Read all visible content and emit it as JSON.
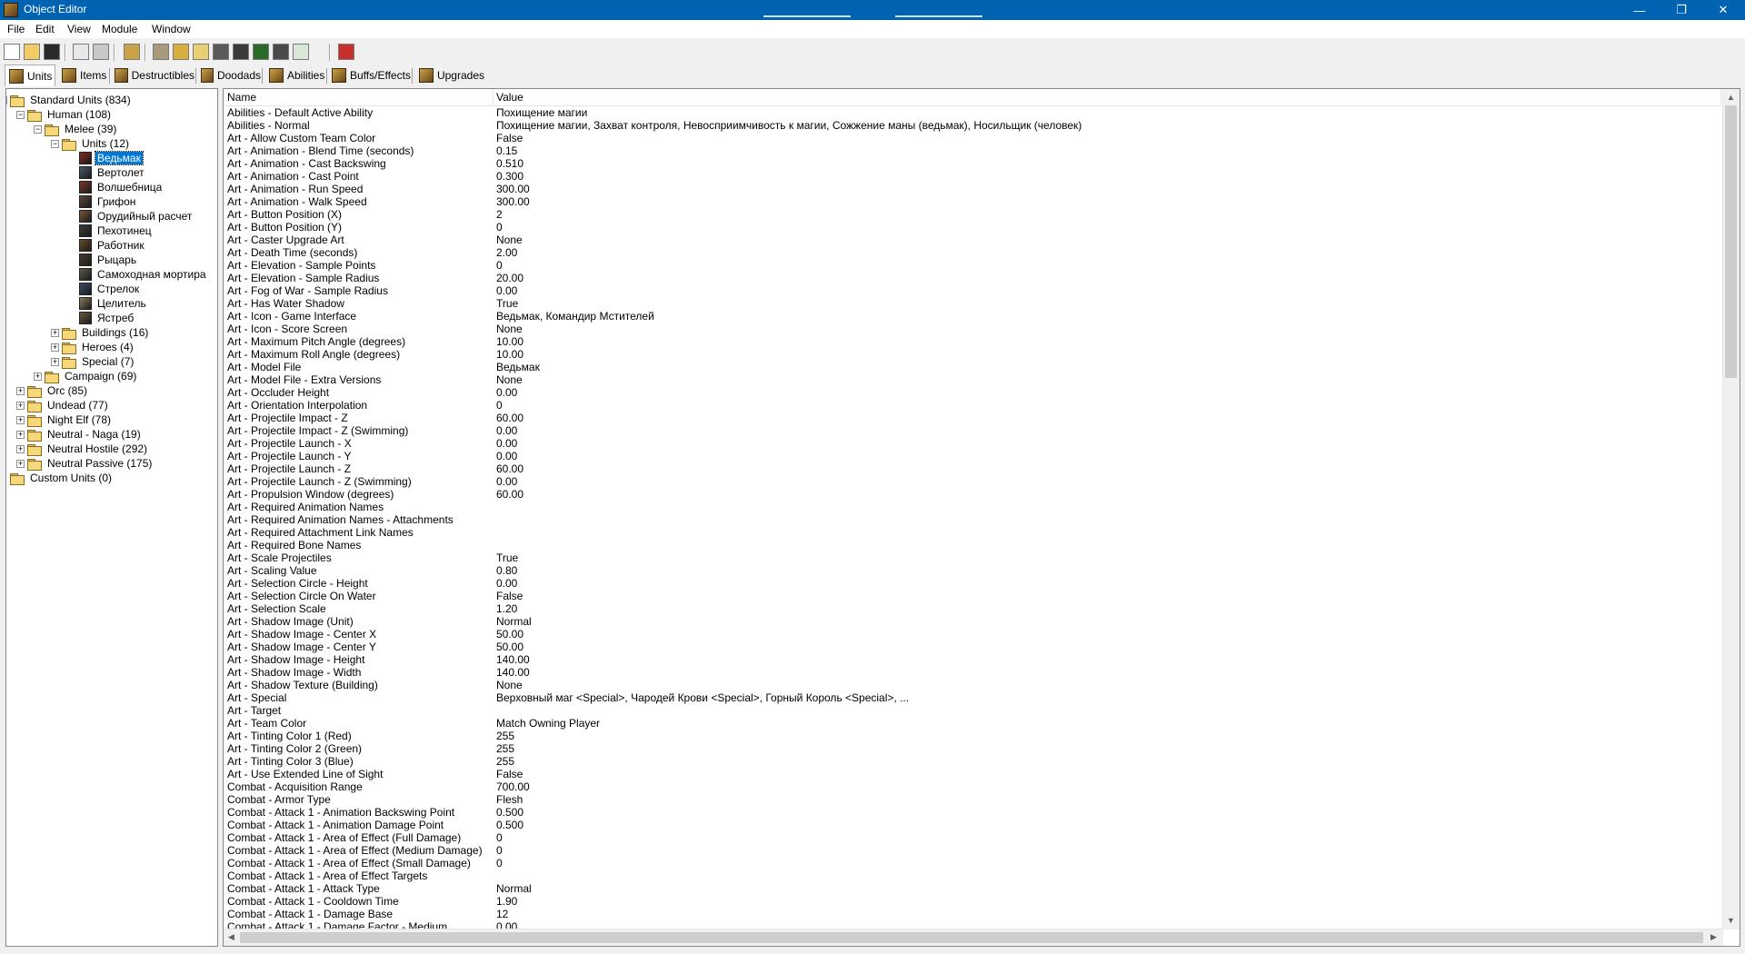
{
  "window": {
    "title": "Object Editor",
    "controls": {
      "minimize": "—",
      "maximize": "❐",
      "close": "✕"
    }
  },
  "menu": [
    "File",
    "Edit",
    "View",
    "Module",
    "Window"
  ],
  "toolbar": {
    "buttons": [
      "new-icon",
      "open-icon",
      "save-icon",
      "copy-icon",
      "paste-icon",
      "unit-icon",
      "terrain-icon",
      "gold-icon",
      "sound-icon",
      "object-icon",
      "camera-icon",
      "map-icon",
      "book-icon",
      "export-icon",
      "import-icon"
    ]
  },
  "tabs": [
    "Units",
    "Items",
    "Destructibles",
    "Doodads",
    "Abilities",
    "Buffs/Effects",
    "Upgrades"
  ],
  "tree": [
    {
      "label": "Standard Units (834)",
      "level": 0,
      "toggle": "-",
      "type": "folder"
    },
    {
      "label": "Human (108)",
      "level": 1,
      "toggle": "-",
      "type": "folder"
    },
    {
      "label": "Melee (39)",
      "level": 2,
      "toggle": "-",
      "type": "folder"
    },
    {
      "label": "Units (12)",
      "level": 3,
      "toggle": "-",
      "type": "folder"
    },
    {
      "label": "Ведьмак",
      "level": 4,
      "type": "unit",
      "selected": true,
      "color": "#8a2a20"
    },
    {
      "label": "Вертолет",
      "level": 4,
      "type": "unit",
      "color": "#4a5a6a"
    },
    {
      "label": "Волшебница",
      "level": 4,
      "type": "unit",
      "color": "#7a3a2a"
    },
    {
      "label": "Грифон",
      "level": 4,
      "type": "unit",
      "color": "#5a4a3a"
    },
    {
      "label": "Орудийный расчет",
      "level": 4,
      "type": "unit",
      "color": "#7a5a3a"
    },
    {
      "label": "Пехотинец",
      "level": 4,
      "type": "unit",
      "color": "#3a3a3a"
    },
    {
      "label": "Работник",
      "level": 4,
      "type": "unit",
      "color": "#6a4a2a"
    },
    {
      "label": "Рыцарь",
      "level": 4,
      "type": "unit",
      "color": "#4a3a2a"
    },
    {
      "label": "Самоходная мортира",
      "level": 4,
      "type": "unit",
      "color": "#5a5a4a"
    },
    {
      "label": "Стрелок",
      "level": 4,
      "type": "unit",
      "color": "#3a4a6a"
    },
    {
      "label": "Целитель",
      "level": 4,
      "type": "unit",
      "color": "#8a7a5a"
    },
    {
      "label": "Ястреб",
      "level": 4,
      "type": "unit",
      "color": "#6a5a3a"
    },
    {
      "label": "Buildings (16)",
      "level": 3,
      "toggle": "+",
      "type": "folder"
    },
    {
      "label": "Heroes (4)",
      "level": 3,
      "toggle": "+",
      "type": "folder"
    },
    {
      "label": "Special (7)",
      "level": 3,
      "toggle": "+",
      "type": "folder"
    },
    {
      "label": "Campaign (69)",
      "level": 2,
      "toggle": "+",
      "type": "folder"
    },
    {
      "label": "Orc (85)",
      "level": 1,
      "toggle": "+",
      "type": "folder"
    },
    {
      "label": "Undead (77)",
      "level": 1,
      "toggle": "+",
      "type": "folder"
    },
    {
      "label": "Night Elf (78)",
      "level": 1,
      "toggle": "+",
      "type": "folder"
    },
    {
      "label": "Neutral - Naga (19)",
      "level": 1,
      "toggle": "+",
      "type": "folder"
    },
    {
      "label": "Neutral Hostile (292)",
      "level": 1,
      "toggle": "+",
      "type": "folder"
    },
    {
      "label": "Neutral Passive (175)",
      "level": 1,
      "toggle": "+",
      "type": "folder"
    },
    {
      "label": "Custom Units (0)",
      "level": 0,
      "type": "folder"
    }
  ],
  "grid": {
    "columns": [
      "Name",
      "Value"
    ],
    "rows": [
      [
        "Abilities - Default Active Ability",
        "Похищение магии"
      ],
      [
        "Abilities - Normal",
        "Похищение магии, Захват контроля, Невосприимчивость к магии, Сожжение маны (ведьмак), Носильщик (человек)"
      ],
      [
        "Art - Allow Custom Team Color",
        "False"
      ],
      [
        "Art - Animation - Blend Time (seconds)",
        "0.15"
      ],
      [
        "Art - Animation - Cast Backswing",
        "0.510"
      ],
      [
        "Art - Animation - Cast Point",
        "0.300"
      ],
      [
        "Art - Animation - Run Speed",
        "300.00"
      ],
      [
        "Art - Animation - Walk Speed",
        "300.00"
      ],
      [
        "Art - Button Position (X)",
        "2"
      ],
      [
        "Art - Button Position (Y)",
        "0"
      ],
      [
        "Art - Caster Upgrade Art",
        "None"
      ],
      [
        "Art - Death Time (seconds)",
        "2.00"
      ],
      [
        "Art - Elevation - Sample Points",
        "0"
      ],
      [
        "Art - Elevation - Sample Radius",
        "20.00"
      ],
      [
        "Art - Fog of War - Sample Radius",
        "0.00"
      ],
      [
        "Art - Has Water Shadow",
        "True"
      ],
      [
        "Art - Icon - Game Interface",
        "Ведьмак, Командир Мстителей"
      ],
      [
        "Art - Icon - Score Screen",
        "None"
      ],
      [
        "Art - Maximum Pitch Angle (degrees)",
        "10.00"
      ],
      [
        "Art - Maximum Roll Angle (degrees)",
        "10.00"
      ],
      [
        "Art - Model File",
        "Ведьмак"
      ],
      [
        "Art - Model File - Extra Versions",
        "None"
      ],
      [
        "Art - Occluder Height",
        "0.00"
      ],
      [
        "Art - Orientation Interpolation",
        "0"
      ],
      [
        "Art - Projectile Impact - Z",
        "60.00"
      ],
      [
        "Art - Projectile Impact - Z (Swimming)",
        "0.00"
      ],
      [
        "Art - Projectile Launch - X",
        "0.00"
      ],
      [
        "Art - Projectile Launch - Y",
        "0.00"
      ],
      [
        "Art - Projectile Launch - Z",
        "60.00"
      ],
      [
        "Art - Projectile Launch - Z (Swimming)",
        "0.00"
      ],
      [
        "Art - Propulsion Window (degrees)",
        "60.00"
      ],
      [
        "Art - Required Animation Names",
        ""
      ],
      [
        "Art - Required Animation Names - Attachments",
        ""
      ],
      [
        "Art - Required Attachment Link Names",
        ""
      ],
      [
        "Art - Required Bone Names",
        ""
      ],
      [
        "Art - Scale Projectiles",
        "True"
      ],
      [
        "Art - Scaling Value",
        "0.80"
      ],
      [
        "Art - Selection Circle - Height",
        "0.00"
      ],
      [
        "Art - Selection Circle On Water",
        "False"
      ],
      [
        "Art - Selection Scale",
        "1.20"
      ],
      [
        "Art - Shadow Image (Unit)",
        "Normal"
      ],
      [
        "Art - Shadow Image - Center X",
        "50.00"
      ],
      [
        "Art - Shadow Image - Center Y",
        "50.00"
      ],
      [
        "Art - Shadow Image - Height",
        "140.00"
      ],
      [
        "Art - Shadow Image - Width",
        "140.00"
      ],
      [
        "Art - Shadow Texture (Building)",
        "None"
      ],
      [
        "Art - Special",
        "Верховный маг <Special>, Чародей Крови <Special>, Горный Король <Special>, ..."
      ],
      [
        "Art - Target",
        ""
      ],
      [
        "Art - Team Color",
        "Match Owning Player"
      ],
      [
        "Art - Tinting Color 1 (Red)",
        "255"
      ],
      [
        "Art - Tinting Color 2 (Green)",
        "255"
      ],
      [
        "Art - Tinting Color 3 (Blue)",
        "255"
      ],
      [
        "Art - Use Extended Line of Sight",
        "False"
      ],
      [
        "Combat - Acquisition Range",
        "700.00"
      ],
      [
        "Combat - Armor Type",
        "Flesh"
      ],
      [
        "Combat - Attack 1 - Animation Backswing Point",
        "0.500"
      ],
      [
        "Combat - Attack 1 - Animation Damage Point",
        "0.500"
      ],
      [
        "Combat - Attack 1 - Area of Effect (Full Damage)",
        "0"
      ],
      [
        "Combat - Attack 1 - Area of Effect (Medium Damage)",
        "0"
      ],
      [
        "Combat - Attack 1 - Area of Effect (Small Damage)",
        "0"
      ],
      [
        "Combat - Attack 1 - Area of Effect Targets",
        ""
      ],
      [
        "Combat - Attack 1 - Attack Type",
        "Normal"
      ],
      [
        "Combat - Attack 1 - Cooldown Time",
        "1.90"
      ],
      [
        "Combat - Attack 1 - Damage Base",
        "12"
      ],
      [
        "Combat - Attack 1 - Damage Factor - Medium",
        "0.00"
      ]
    ]
  },
  "colors": {
    "title_bar": "#0063b1",
    "selection": "#0078d7"
  }
}
